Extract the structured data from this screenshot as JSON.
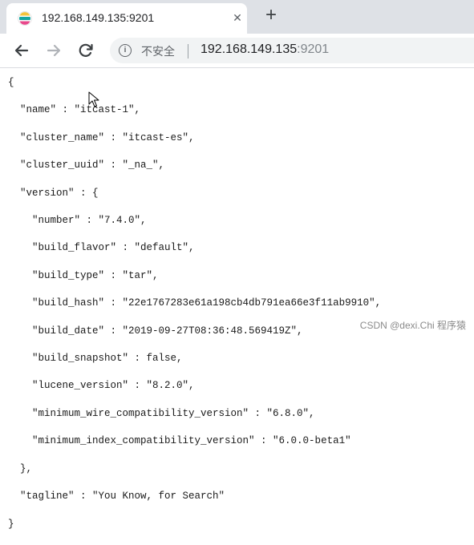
{
  "browser": {
    "tab": {
      "title": "192.168.149.135:9201",
      "close_label": "✕"
    },
    "new_tab_label": "+",
    "security_label": "不安全",
    "address": {
      "host": "192.168.149.135",
      "port": ":9201"
    },
    "colors": {
      "tabstrip": "#dee1e6",
      "favicon_teal": "#17a6a1",
      "favicon_yellow": "#f5c33b",
      "favicon_pink": "#e8488b"
    }
  },
  "json_response": {
    "lines": [
      "{",
      "  \"name\" : \"itcast-1\",",
      "  \"cluster_name\" : \"itcast-es\",",
      "  \"cluster_uuid\" : \"_na_\",",
      "  \"version\" : {",
      "    \"number\" : \"7.4.0\",",
      "    \"build_flavor\" : \"default\",",
      "    \"build_type\" : \"tar\",",
      "    \"build_hash\" : \"22e1767283e61a198cb4db791ea66e3f11ab9910\",",
      "    \"build_date\" : \"2019-09-27T08:36:48.569419Z\",",
      "    \"build_snapshot\" : false,",
      "    \"lucene_version\" : \"8.2.0\",",
      "    \"minimum_wire_compatibility_version\" : \"6.8.0\",",
      "    \"minimum_index_compatibility_version\" : \"6.0.0-beta1\"",
      "  },",
      "  \"tagline\" : \"You Know, for Search\"",
      "}"
    ]
  },
  "watermark": "CSDN @dexi.Chi 程序猿"
}
